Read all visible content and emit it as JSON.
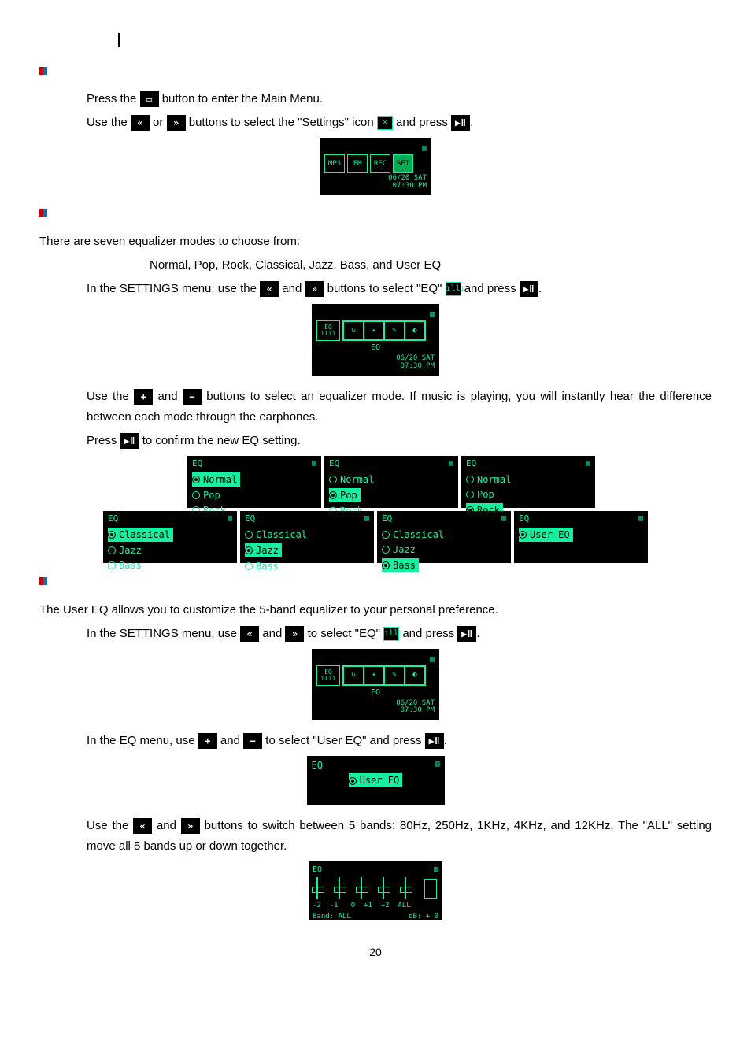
{
  "page_number": "20",
  "s1": {
    "line1a": "Press the ",
    "line1b": " button to enter the Main Menu.",
    "line2a": "Use the ",
    "line2_or": " or ",
    "line2b": " buttons to select the \"Settings\" icon ",
    "line2c": " and press ",
    "period": "."
  },
  "screen1": {
    "tiles": [
      "MP3",
      "FM",
      "REC",
      "SET"
    ],
    "ts1": "06/20 SAT",
    "ts2": "07:30 PM"
  },
  "s2": {
    "intro": "There are seven equalizer modes to choose from:",
    "modes": "Normal, Pop, Rock, Classical, Jazz, Bass, and User EQ",
    "l1a": "In the SETTINGS menu, use the ",
    "and": " and ",
    "l1b": " buttons to select \"EQ\" ",
    "l1c": " and press ",
    "l2a": "Use the ",
    "l2b": " buttons to select an equalizer mode. If music is playing, you will instantly hear the difference between each mode through the earphones.",
    "l3a": "Press ",
    "l3b": " to confirm the new EQ setting."
  },
  "screen2": {
    "label": "EQ",
    "ts1": "06/20 SAT",
    "ts2": "07:30 PM"
  },
  "eq_screens": [
    {
      "hdr": "EQ",
      "opts": [
        "Normal",
        "Pop",
        "Rock"
      ],
      "sel": 0
    },
    {
      "hdr": "EQ",
      "opts": [
        "Normal",
        "Pop",
        "Rock"
      ],
      "sel": 1
    },
    {
      "hdr": "EQ",
      "opts": [
        "Normal",
        "Pop",
        "Rock"
      ],
      "sel": 2
    },
    {
      "hdr": "EQ",
      "opts": [
        "Classical",
        "Jazz",
        "Bass"
      ],
      "sel": 0
    },
    {
      "hdr": "EQ",
      "opts": [
        "Classical",
        "Jazz",
        "Bass"
      ],
      "sel": 1
    },
    {
      "hdr": "EQ",
      "opts": [
        "Classical",
        "Jazz",
        "Bass"
      ],
      "sel": 2
    },
    {
      "hdr": "EQ",
      "opts": [
        "User EQ"
      ],
      "sel": 0
    }
  ],
  "s3": {
    "intro": "The User EQ allows you to customize the 5-band equalizer to your personal preference.",
    "l1a": "In the SETTINGS menu, use ",
    "l1b": " to select \"EQ\" ",
    "l1c": " and press ",
    "l2a": "In the EQ menu, use ",
    "l2b": " to select \"User EQ\" and press ",
    "l3a": "Use the ",
    "l3b": " buttons to switch between 5 bands: 80Hz, 250Hz, 1KHz, 4KHz, and 12KHz. The \"ALL\" setting move all 5 bands up or down together."
  },
  "user_eq_screen": {
    "hdr": "EQ",
    "opt": "User EQ"
  },
  "band_screen": {
    "hdr": "EQ",
    "ticks": "-2  -1   0  +1  +2  ALL",
    "l1": "Band: ALL",
    "l2": "dB: + 0"
  },
  "btn_labels": {
    "menu": "▭",
    "prev": "«",
    "next": "»",
    "play": "▶ǁ",
    "plus": "+",
    "minus": "−"
  }
}
